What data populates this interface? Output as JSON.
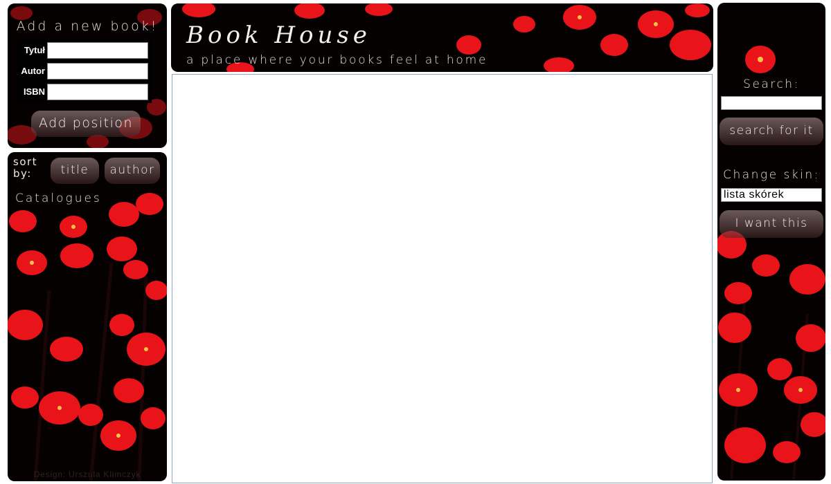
{
  "add_form": {
    "title": "Add a new book!",
    "fields": [
      {
        "label": "Tytuł",
        "value": ""
      },
      {
        "label": "Autor",
        "value": ""
      },
      {
        "label": "ISBN",
        "value": ""
      }
    ],
    "submit_label": "Add position"
  },
  "list_panel": {
    "sort_label": "sort by:",
    "sort_title": "title",
    "sort_author": "author",
    "catalogues_label": "Catalogues",
    "credit": "Design: Urszula Klimczyk"
  },
  "header": {
    "title": "Book House",
    "tagline": "a place where your books feel at home"
  },
  "right_panel": {
    "search_label": "Search:",
    "search_value": "",
    "search_button": "search for it",
    "skin_label": "Change skin:",
    "skin_selected": "lista skórek",
    "skin_button": "I want this"
  },
  "colors": {
    "panel_bg": "#060101",
    "flower_red": "#e8141a",
    "content_border": "#8ea6c6"
  }
}
